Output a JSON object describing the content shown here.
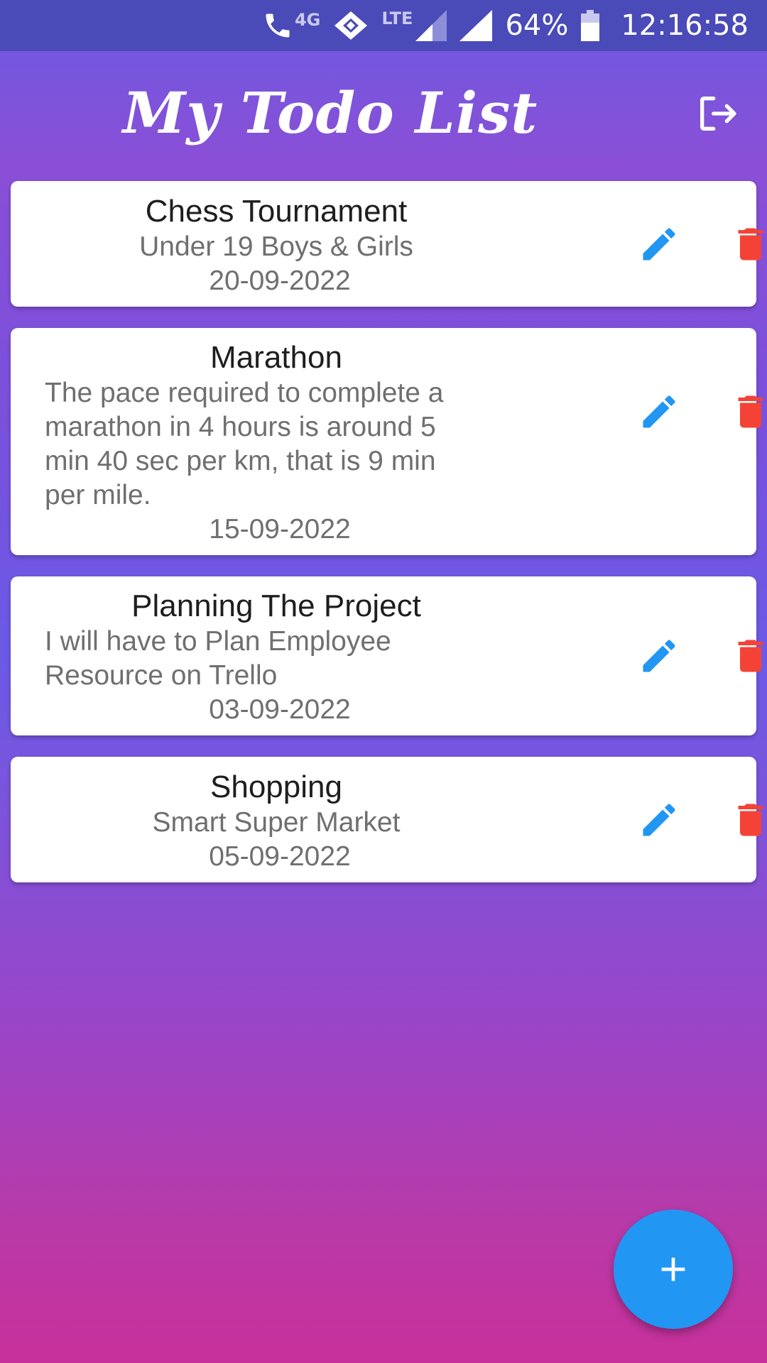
{
  "status_bar": {
    "network": "4G",
    "lte": "LTE",
    "battery": "64%",
    "time": "12:16:58"
  },
  "header": {
    "title": "My Todo List",
    "logout_icon": "logout-icon"
  },
  "todos": [
    {
      "title": "Chess Tournament",
      "description": "Under 19 Boys & Girls",
      "date": "20-09-2022"
    },
    {
      "title": "Marathon",
      "description": "The pace required to complete a marathon in 4 hours is around 5 min 40 sec per km, that is 9 min per mile.",
      "date": "15-09-2022"
    },
    {
      "title": "Planning The Project",
      "description": "I will have to Plan Employee Resource on Trello",
      "date": "03-09-2022"
    },
    {
      "title": "Shopping",
      "description": "Smart Super Market",
      "date": "05-09-2022"
    }
  ],
  "fab": {
    "icon": "plus-icon"
  },
  "colors": {
    "edit": "#2196f3",
    "delete": "#f44336",
    "fab": "#2196f3"
  }
}
